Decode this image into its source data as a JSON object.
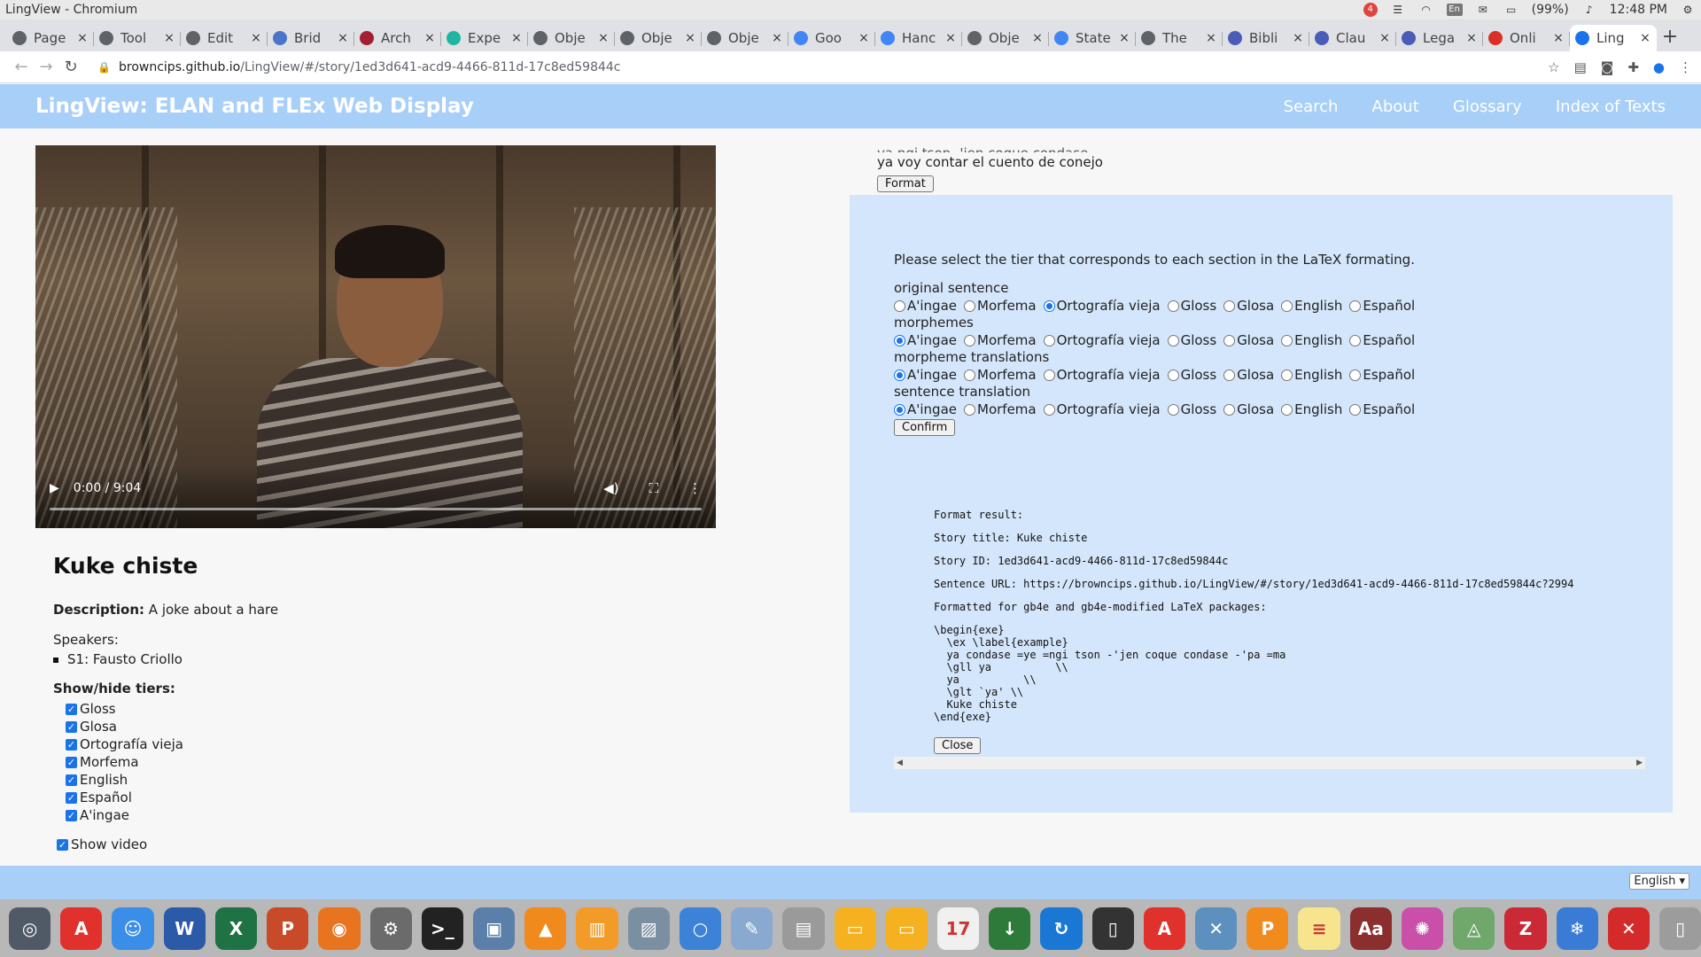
{
  "system": {
    "app_title": "LingView - Chromium",
    "notif_count": "4",
    "lang_indicator": "En",
    "battery": "(99%)",
    "clock": "12:48 PM"
  },
  "tabs": [
    {
      "label": "Page",
      "icon": "page-icon",
      "color": "#5f6368"
    },
    {
      "label": "Tool",
      "icon": "github-icon",
      "color": "#5f6368"
    },
    {
      "label": "Edit",
      "icon": "github-icon",
      "color": "#5f6368"
    },
    {
      "label": "Brid",
      "icon": "bridge-icon",
      "color": "#4a74c8"
    },
    {
      "label": "Arch",
      "icon": "shield-icon",
      "color": "#a31f34"
    },
    {
      "label": "Expe",
      "icon": "expe-icon",
      "color": "#1fb5a3"
    },
    {
      "label": "Obje",
      "icon": "github-icon",
      "color": "#5f6368"
    },
    {
      "label": "Obje",
      "icon": "github-icon",
      "color": "#5f6368"
    },
    {
      "label": "Obje",
      "icon": "github-icon",
      "color": "#5f6368"
    },
    {
      "label": "Goo",
      "icon": "translate-icon",
      "color": "#4285f4"
    },
    {
      "label": "Hanc",
      "icon": "google-icon",
      "color": "#4285f4"
    },
    {
      "label": "Obje",
      "icon": "github-icon",
      "color": "#5f6368"
    },
    {
      "label": "State",
      "icon": "docs-icon",
      "color": "#4285f4"
    },
    {
      "label": "The",
      "icon": "github-icon",
      "color": "#5f6368"
    },
    {
      "label": "Bibli",
      "icon": "scholar-icon",
      "color": "#4a5bb8"
    },
    {
      "label": "Clau",
      "icon": "scholar-icon",
      "color": "#4a5bb8"
    },
    {
      "label": "Lega",
      "icon": "scholar-icon",
      "color": "#4a5bb8"
    },
    {
      "label": "Onli",
      "icon": "gmail-icon",
      "color": "#d93025"
    },
    {
      "label": "Ling",
      "icon": "globe-icon",
      "color": "#1a73e8",
      "active": true
    }
  ],
  "address": {
    "host": "browncips.github.io",
    "path": "/LingView/#/story/1ed3d641-acd9-4466-811d-17c8ed59844c"
  },
  "header": {
    "title": "LingView: ELAN and FLEx Web Display",
    "nav": [
      "Search",
      "About",
      "Glossary",
      "Index of Texts"
    ]
  },
  "video": {
    "time": "0:00 / 9:04"
  },
  "story": {
    "title": "Kuke chiste",
    "description_label": "Description:",
    "description": "A joke about a hare",
    "speakers_label": "Speakers:",
    "speakers": [
      "S1: Fausto Criollo"
    ],
    "tiers_label": "Show/hide tiers:",
    "tiers": [
      "Gloss",
      "Glosa",
      "Ortografía vieja",
      "Morfema",
      "English",
      "Español",
      "A'ingae"
    ],
    "show_video_label": "Show video"
  },
  "sentence": {
    "partial_line": "ya ngi tson -'jen coque condase",
    "text": "ya voy contar el cuento de conejo",
    "format_label": "Format"
  },
  "latex_panel": {
    "instructions": "Please select the tier that corresponds to each section in the LaTeX formating.",
    "options": [
      "A'ingae",
      "Morfema",
      "Ortografía vieja",
      "Gloss",
      "Glosa",
      "English",
      "Español"
    ],
    "groups": [
      {
        "label": "original sentence",
        "selected": "Ortografía vieja"
      },
      {
        "label": "morphemes",
        "selected": "A'ingae"
      },
      {
        "label": "morpheme translations",
        "selected": "A'ingae"
      },
      {
        "label": "sentence translation",
        "selected": "A'ingae"
      }
    ],
    "confirm_label": "Confirm",
    "result": {
      "header": "Format result:",
      "story_title": "Story title: Kuke chiste",
      "story_id": "Story ID: 1ed3d641-acd9-4466-811d-17c8ed59844c",
      "sentence_url": "Sentence URL: https://browncips.github.io/LingView/#/story/1ed3d641-acd9-4466-811d-17c8ed59844c?2994",
      "formatted_for": "Formatted for gb4e and gb4e-modified LaTeX packages:",
      "code": "\\begin{exe}\n  \\ex \\label{example}\n  ya condase =ye =ngi tson -'jen coque condase -'pa =ma\n  \\gll ya          \\\\\n  ya          \\\\\n  \\glt `ya' \\\\\n  Kuke chiste\n\\end{exe}"
    },
    "close_label": "Close"
  },
  "footer": {
    "language": "English"
  },
  "dock": [
    {
      "name": "chrome-dock-icon",
      "color": "#4f5a66",
      "glyph": "◎"
    },
    {
      "name": "acrobat-dock-icon",
      "color": "#e0312c",
      "glyph": "A"
    },
    {
      "name": "finder-dock-icon",
      "color": "#3b8ee8",
      "glyph": "☺"
    },
    {
      "name": "word-dock-icon",
      "color": "#2b5aa8",
      "glyph": "W"
    },
    {
      "name": "excel-dock-icon",
      "color": "#1f7244",
      "glyph": "X"
    },
    {
      "name": "powerpoint-dock-icon",
      "color": "#c84a28",
      "glyph": "P"
    },
    {
      "name": "firefox-dock-icon",
      "color": "#e8741f",
      "glyph": "◉"
    },
    {
      "name": "settings-dock-icon",
      "color": "#6b6b6b",
      "glyph": "⚙"
    },
    {
      "name": "terminal-dock-icon",
      "color": "#222222",
      "glyph": ">_"
    },
    {
      "name": "preview-dock-icon",
      "color": "#5a7fa8",
      "glyph": "▣"
    },
    {
      "name": "vlc-dock-icon",
      "color": "#f08a1c",
      "glyph": "▲"
    },
    {
      "name": "books-dock-icon",
      "color": "#f29b29",
      "glyph": "▥"
    },
    {
      "name": "photos-dock-icon",
      "color": "#7b8fa3",
      "glyph": "▨"
    },
    {
      "name": "chromium-dock-icon",
      "color": "#3c82d6",
      "glyph": "○"
    },
    {
      "name": "script-dock-icon",
      "color": "#8aa9d0",
      "glyph": "✎"
    },
    {
      "name": "drive-dock-icon",
      "color": "#9a9a9a",
      "glyph": "▤"
    },
    {
      "name": "folder-dock-icon",
      "color": "#f5b120",
      "glyph": "▭"
    },
    {
      "name": "folder2-dock-icon",
      "color": "#f5b120",
      "glyph": "▭"
    },
    {
      "name": "calendar-dock-icon",
      "color": "#f0f0f0",
      "glyph": "17"
    },
    {
      "name": "download-dock-icon",
      "color": "#2e7a3a",
      "glyph": "↓"
    },
    {
      "name": "sync-dock-icon",
      "color": "#1a78d4",
      "glyph": "↻"
    },
    {
      "name": "screen-dock-icon",
      "color": "#333333",
      "glyph": "▯"
    },
    {
      "name": "acrobat2-dock-icon",
      "color": "#e0312c",
      "glyph": "A"
    },
    {
      "name": "xcode-dock-icon",
      "color": "#5d8fbf",
      "glyph": "✕"
    },
    {
      "name": "pages-dock-icon",
      "color": "#f28b1e",
      "glyph": "P"
    },
    {
      "name": "notes-dock-icon",
      "color": "#f6e58d",
      "glyph": "≡"
    },
    {
      "name": "dictionary-dock-icon",
      "color": "#8b2e2e",
      "glyph": "Aa"
    },
    {
      "name": "pinwheel-dock-icon",
      "color": "#c94fa8",
      "glyph": "✺"
    },
    {
      "name": "maps-dock-icon",
      "color": "#6fa86a",
      "glyph": "◬"
    },
    {
      "name": "zotero-dock-icon",
      "color": "#cc2936",
      "glyph": "Z"
    },
    {
      "name": "launchpad-dock-icon",
      "color": "#3a7bd5",
      "glyph": "❄"
    },
    {
      "name": "crossover-dock-icon",
      "color": "#d42a2a",
      "glyph": "✕"
    },
    {
      "name": "trash-dock-icon",
      "color": "#9c9c9c",
      "glyph": "▯"
    }
  ]
}
